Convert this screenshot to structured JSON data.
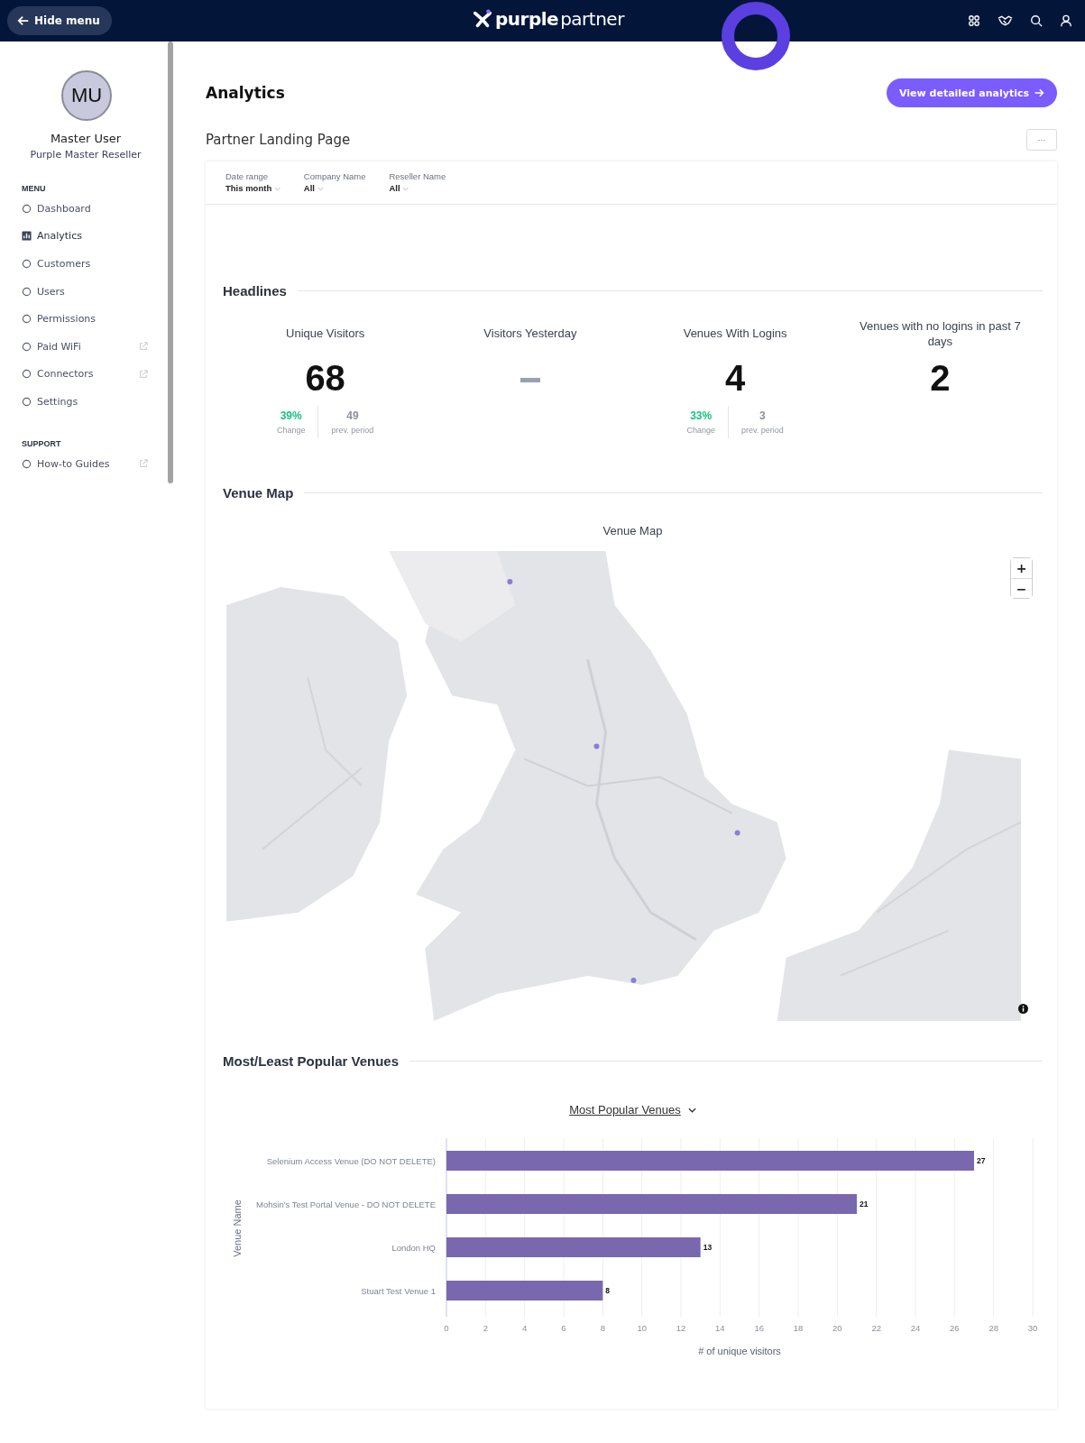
{
  "header": {
    "back_button": "Hide menu",
    "logo": {
      "bold": "purple",
      "light": "partner"
    }
  },
  "sidebar": {
    "avatar": "MU",
    "user_name": "Master User",
    "user_role": "Purple Master Reseller",
    "sections": [
      {
        "heading": "MENU",
        "items": [
          {
            "label": "Dashboard",
            "selected": false,
            "external": false
          },
          {
            "label": "Analytics",
            "selected": true,
            "external": false
          },
          {
            "label": "Customers",
            "selected": false,
            "external": false
          },
          {
            "label": "Users",
            "selected": false,
            "external": false
          },
          {
            "label": "Permissions",
            "selected": false,
            "external": false
          },
          {
            "label": "Paid WiFi",
            "selected": false,
            "external": true
          },
          {
            "label": "Connectors",
            "selected": false,
            "external": true
          },
          {
            "label": "Settings",
            "selected": false,
            "external": false
          }
        ]
      },
      {
        "heading": "SUPPORT",
        "items": [
          {
            "label": "How-to Guides",
            "selected": false,
            "external": true
          }
        ]
      }
    ]
  },
  "page": {
    "title": "Analytics",
    "action_button": "View detailed analytics",
    "subtitle": "Partner Landing Page",
    "more_button": "···"
  },
  "filters": [
    {
      "label": "Date range",
      "value": "This month"
    },
    {
      "label": "Company Name",
      "value": "All"
    },
    {
      "label": "Reseller Name",
      "value": "All"
    }
  ],
  "headlines": {
    "title": "Headlines",
    "metrics": [
      {
        "kind": "comparison",
        "label": "Unique Visitors",
        "value": "68",
        "change": "39%",
        "change_label": "Change",
        "previous": "49",
        "previous_label": "prev. period"
      },
      {
        "kind": "empty",
        "label": "Visitors Yesterday"
      },
      {
        "kind": "comparison",
        "label": "Venues With Logins",
        "value": "4",
        "change": "33%",
        "change_label": "Change",
        "previous": "3",
        "previous_label": "prev. period"
      },
      {
        "kind": "plain",
        "label": "Venues with no logins in past 7 days",
        "value": "2"
      }
    ]
  },
  "venue_map": {
    "title": "Venue Map",
    "map_title": "Venue Map",
    "zoom_in": "+",
    "zoom_out": "−"
  },
  "popular_venues": {
    "title": "Most/Least Popular Venues",
    "selector": "Most Popular Venues",
    "chart_data": {
      "type": "bar",
      "orientation": "horizontal",
      "xlabel": "# of unique visitors",
      "ylabel": "Venue Name",
      "categories": [
        "Selenium Access Venue (DO NOT DELETE)",
        "Mohsin's Test Portal Venue - DO NOT DELETE",
        "London HQ",
        "Stuart Test Venue 1"
      ],
      "series": [
        {
          "color": "#7a68ae",
          "values": [
            27,
            21,
            13,
            8
          ]
        }
      ],
      "xlim": [
        0,
        30
      ],
      "xticks": [
        0,
        2,
        4,
        6,
        8,
        10,
        12,
        14,
        16,
        18,
        20,
        22,
        24,
        26,
        28,
        30
      ],
      "data_labels": true,
      "grid": true
    }
  }
}
